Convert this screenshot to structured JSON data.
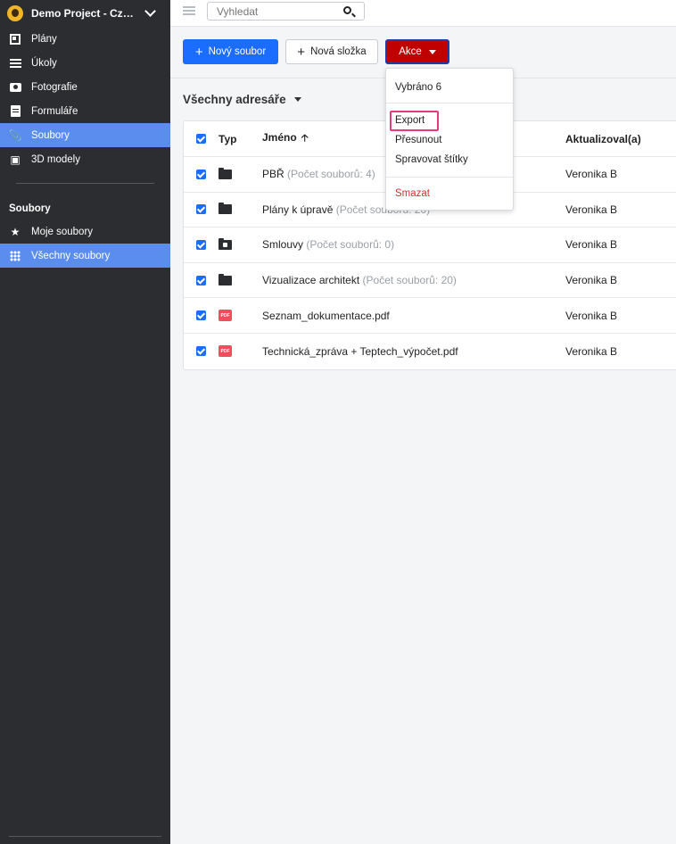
{
  "project": {
    "name": "Demo Project - Czech Demo"
  },
  "sidebar": {
    "items": [
      {
        "label": "Plány",
        "icon": "plans-icon",
        "active": false
      },
      {
        "label": "Úkoly",
        "icon": "tasks-icon",
        "active": false
      },
      {
        "label": "Fotografie",
        "icon": "camera-icon",
        "active": false
      },
      {
        "label": "Formuláře",
        "icon": "forms-icon",
        "active": false
      },
      {
        "label": "Soubory",
        "icon": "paperclip-icon",
        "active": true
      },
      {
        "label": "3D modely",
        "icon": "cube-icon",
        "active": false
      }
    ],
    "section_title": "Soubory",
    "sub_items": [
      {
        "label": "Moje soubory",
        "icon": "star-icon",
        "active": false
      },
      {
        "label": "Všechny soubory",
        "icon": "grid-icon",
        "active": true
      }
    ]
  },
  "search": {
    "placeholder": "Vyhledat",
    "value": ""
  },
  "toolbar": {
    "new_file": "Nový soubor",
    "new_folder": "Nová složka",
    "actions": "Akce"
  },
  "directory_title": "Všechny adresáře",
  "table": {
    "headers": {
      "type": "Typ",
      "name": "Jméno",
      "updated_by": "Aktualizoval(a)"
    },
    "rows": [
      {
        "type": "folder",
        "name": "PBŘ",
        "count": "(Počet souborů: 4)",
        "updated_by": "Veronika B"
      },
      {
        "type": "folder",
        "name": "Plány k úpravě",
        "count": "(Počet souborů: 20)",
        "updated_by": "Veronika B"
      },
      {
        "type": "locked-folder",
        "name": "Smlouvy",
        "count": "(Počet souborů: 0)",
        "updated_by": "Veronika B"
      },
      {
        "type": "folder",
        "name": "Vizualizace architekt",
        "count": "(Počet souborů: 20)",
        "updated_by": "Veronika B"
      },
      {
        "type": "pdf",
        "name": "Seznam_dokumentace.pdf",
        "count": "",
        "updated_by": "Veronika B"
      },
      {
        "type": "pdf",
        "name": "Technická_zpráva + Teptech_výpočet.pdf",
        "count": "",
        "updated_by": "Veronika B"
      }
    ]
  },
  "pdf_label": "PDF",
  "menu": {
    "selected": "Vybráno 6",
    "export": "Export",
    "move": "Přesunout",
    "manage_tags": "Spravovat štítky",
    "delete": "Smazat"
  },
  "colors": {
    "sidebar_bg": "#2b2d30",
    "active": "#5b8def",
    "primary": "#1a6dff",
    "danger": "#c00000",
    "highlight": "#e83a7a"
  }
}
